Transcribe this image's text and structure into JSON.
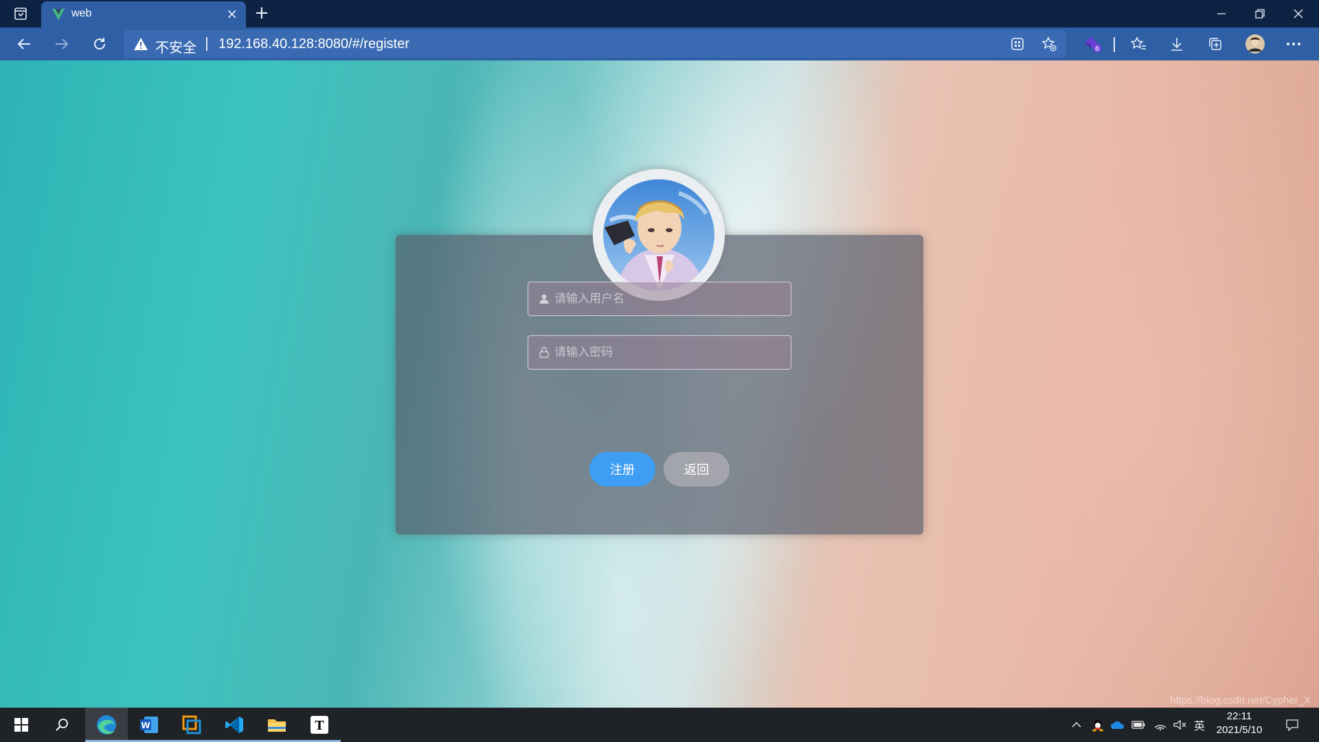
{
  "browser": {
    "tab_title": "web",
    "tab_close": "×",
    "new_tab": "+",
    "security_label": "不安全",
    "url": "192.168.40.128:8080/#/register",
    "extension_badge": "6"
  },
  "form": {
    "username_placeholder": "请输入用户名",
    "password_placeholder": "请输入密码",
    "register_label": "注册",
    "back_label": "返回"
  },
  "watermark": "https://blog.csdn.net/Cypher_X",
  "taskbar": {
    "time": "22:11",
    "date": "2021/5/10",
    "ime": "英"
  },
  "colors": {
    "primary": "#3e9ef4",
    "tab_active": "#2f5fa5",
    "tabbar": "#0d2343"
  }
}
